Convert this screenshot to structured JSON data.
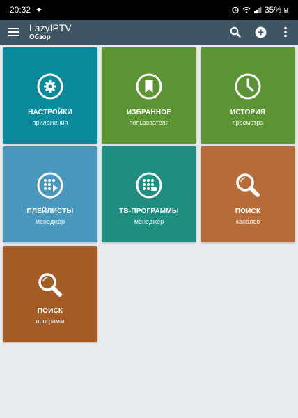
{
  "status_bar": {
    "time": "20:32",
    "battery": "35%"
  },
  "app_bar": {
    "title": "LazyIPTV",
    "subtitle": "Обзор"
  },
  "tiles": [
    {
      "title": "НАСТРОЙКИ",
      "subtitle": "приложения",
      "color": "#0b8a9b",
      "icon": "gear-icon"
    },
    {
      "title": "ИЗБРАННОЕ",
      "subtitle": "пользователя",
      "color": "#5c9334",
      "icon": "bookmark-icon"
    },
    {
      "title": "ИСТОРИЯ",
      "subtitle": "просмотра",
      "color": "#5c9334",
      "icon": "clock-icon"
    },
    {
      "title": "ПЛЕЙЛИСТЫ",
      "subtitle": "менеджер",
      "color": "#4a97bd",
      "icon": "playlist-icon"
    },
    {
      "title": "ТВ-ПРОГРАММЫ",
      "subtitle": "менеджер",
      "color": "#1f8d80",
      "icon": "tv-program-icon"
    },
    {
      "title": "ПОИСК",
      "subtitle": "каналов",
      "color": "#b56c39",
      "icon": "search-icon"
    },
    {
      "title": "ПОИСК",
      "subtitle": "программ",
      "color": "#a45c26",
      "icon": "search-icon"
    }
  ]
}
